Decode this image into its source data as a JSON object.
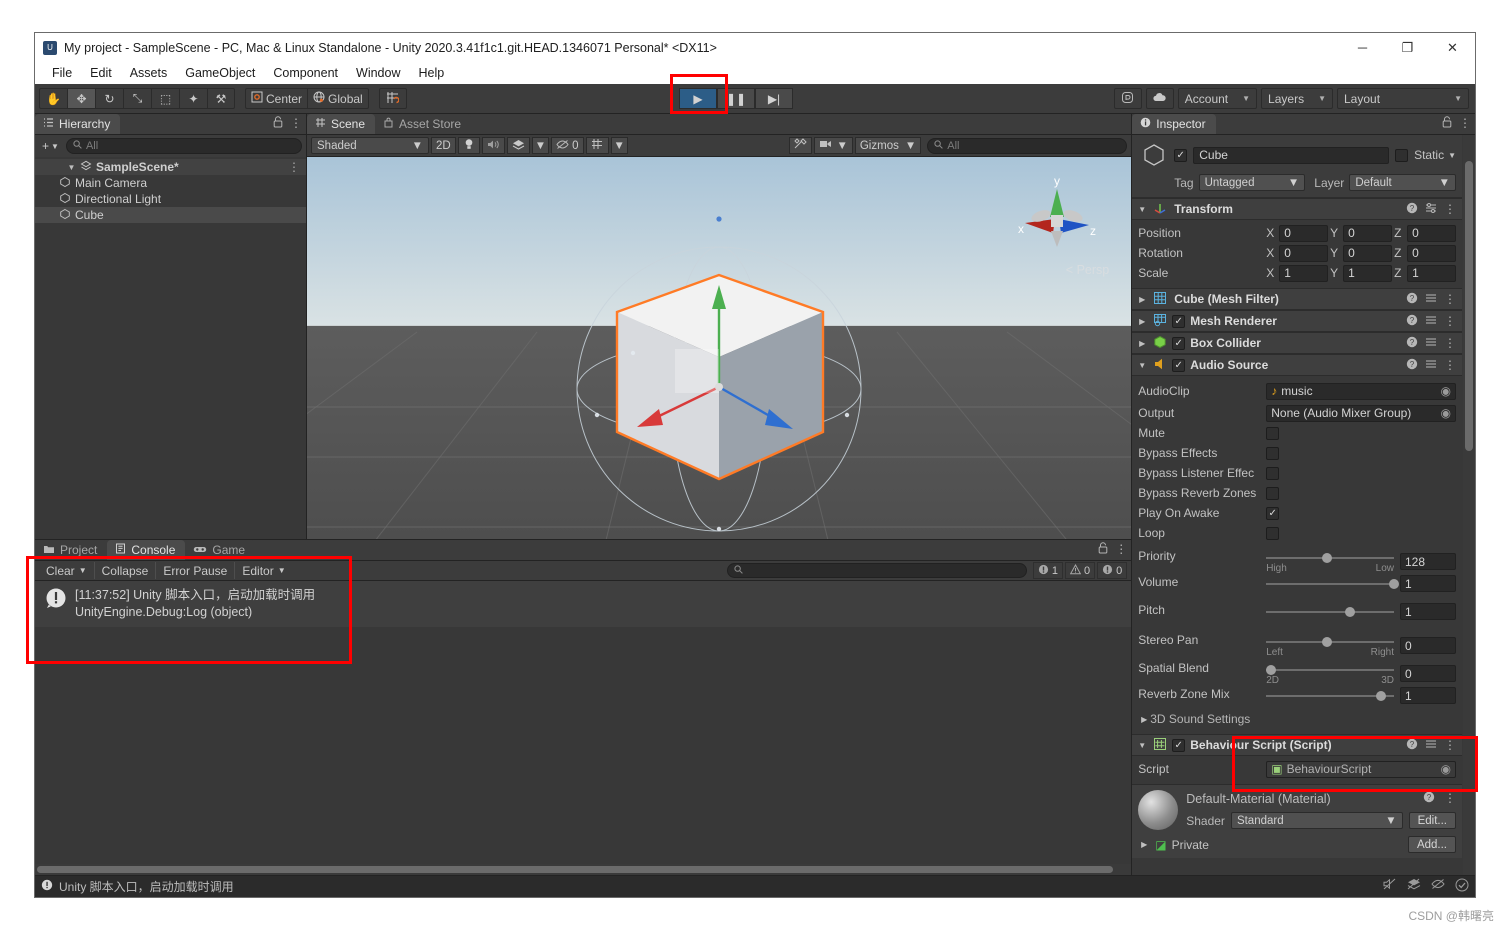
{
  "window": {
    "title": "My project - SampleScene - PC, Mac & Linux Standalone - Unity 2020.3.41f1c1.git.HEAD.1346071 Personal* <DX11>",
    "minimize": "─",
    "maximize": "❐",
    "close": "✕"
  },
  "menu": {
    "items": [
      "File",
      "Edit",
      "Assets",
      "GameObject",
      "Component",
      "Window",
      "Help"
    ]
  },
  "toolbar": {
    "tools": [
      {
        "name": "hand-tool",
        "glyph": "✋",
        "active": false
      },
      {
        "name": "move-tool",
        "glyph": "✥",
        "active": true
      },
      {
        "name": "rotate-tool",
        "glyph": "↻",
        "active": false
      },
      {
        "name": "scale-tool",
        "glyph": "⤡",
        "active": false
      },
      {
        "name": "rect-tool",
        "glyph": "⬚",
        "active": false
      },
      {
        "name": "transform-tool",
        "glyph": "✦",
        "active": false
      },
      {
        "name": "custom-tool",
        "glyph": "⚒",
        "active": false
      }
    ],
    "pivot_label": "Center",
    "space_label": "Global",
    "snap_label": "grid-snapping",
    "play_label": "▶",
    "pause_label": "❚❚",
    "step_label": "▶|",
    "collab_label": "collab-icon",
    "cloud_label": "cloud-icon",
    "account_label": "Account",
    "layers_label": "Layers",
    "layout_label": "Layout"
  },
  "hierarchy": {
    "tab_label": "Hierarchy",
    "add_label": "+",
    "search_placeholder": "All",
    "items": [
      {
        "label": "SampleScene*",
        "icon": "scene-icon",
        "depth": 0,
        "selected": false,
        "expanded": true
      },
      {
        "label": "Main Camera",
        "icon": "gameobject-icon",
        "depth": 1,
        "selected": false
      },
      {
        "label": "Directional Light",
        "icon": "gameobject-icon",
        "depth": 1,
        "selected": false
      },
      {
        "label": "Cube",
        "icon": "gameobject-icon",
        "depth": 1,
        "selected": true
      }
    ]
  },
  "scene": {
    "tabs": [
      {
        "label": "Scene",
        "active": true
      },
      {
        "label": "Asset Store",
        "active": false
      }
    ],
    "shading_label": "Shaded",
    "mode_2d_label": "2D",
    "lighting_label": "lighting-icon",
    "audio_label": "audio-icon",
    "fx_label": "fx-icon",
    "hidden_count": "0",
    "grid_label": "grid-icon",
    "gizmos_label": "Gizmos",
    "search_placeholder": "All",
    "persp_label": "< Persp",
    "axis_x": "x",
    "axis_y": "y",
    "axis_z": "z"
  },
  "console": {
    "tabs": [
      {
        "label": "Project",
        "active": false,
        "icon": "folder-icon"
      },
      {
        "label": "Console",
        "active": true,
        "icon": "console-icon"
      },
      {
        "label": "Game",
        "active": false,
        "icon": "game-icon"
      }
    ],
    "clear_label": "Clear",
    "collapse_label": "Collapse",
    "error_pause_label": "Error Pause",
    "editor_label": "Editor",
    "search_placeholder": "",
    "counts": {
      "info": "1",
      "warning": "0",
      "error": "0"
    },
    "log": {
      "line1": "[11:37:52] Unity 脚本入口，启动加载时调用",
      "line2": "UnityEngine.Debug:Log (object)"
    }
  },
  "inspector": {
    "tab_label": "Inspector",
    "object_name": "Cube",
    "object_enabled": true,
    "static_label": "Static",
    "tag_label": "Tag",
    "tag_value": "Untagged",
    "layer_label": "Layer",
    "layer_value": "Default",
    "transform": {
      "title": "Transform",
      "rows": [
        {
          "label": "Position",
          "x": "0",
          "y": "0",
          "z": "0"
        },
        {
          "label": "Rotation",
          "x": "0",
          "y": "0",
          "z": "0"
        },
        {
          "label": "Scale",
          "x": "1",
          "y": "1",
          "z": "1"
        }
      ],
      "axis_x": "X",
      "axis_y": "Y",
      "axis_z": "Z"
    },
    "components": [
      {
        "title": "Cube (Mesh Filter)",
        "icon": "mesh-filter-icon",
        "has_toggle": false,
        "expanded": false
      },
      {
        "title": "Mesh Renderer",
        "icon": "mesh-renderer-icon",
        "has_toggle": true,
        "checked": true,
        "expanded": false
      },
      {
        "title": "Box Collider",
        "icon": "box-collider-icon",
        "has_toggle": true,
        "checked": true,
        "expanded": false
      },
      {
        "title": "Audio Source",
        "icon": "audio-source-icon",
        "has_toggle": true,
        "checked": true,
        "expanded": true
      }
    ],
    "audio_source": {
      "audioclip_label": "AudioClip",
      "audioclip_value": "music",
      "output_label": "Output",
      "output_value": "None (Audio Mixer Group)",
      "mute_label": "Mute",
      "mute_checked": false,
      "bypass_effects_label": "Bypass Effects",
      "bypass_effects_checked": false,
      "bypass_listener_label": "Bypass Listener Effec",
      "bypass_listener_checked": false,
      "bypass_reverb_label": "Bypass Reverb Zones",
      "bypass_reverb_checked": false,
      "play_on_awake_label": "Play On Awake",
      "play_on_awake_checked": true,
      "loop_label": "Loop",
      "loop_checked": false,
      "sliders": [
        {
          "label": "Priority",
          "value": "128",
          "pos": 46,
          "left": "High",
          "right": "Low"
        },
        {
          "label": "Volume",
          "value": "1",
          "pos": 100,
          "left": "",
          "right": ""
        },
        {
          "label": "Pitch",
          "value": "1",
          "pos": 65,
          "left": "",
          "right": ""
        },
        {
          "label": "Stereo Pan",
          "value": "0",
          "pos": 46,
          "left": "Left",
          "right": "Right"
        },
        {
          "label": "Spatial Blend",
          "value": "0",
          "pos": 2,
          "left": "2D",
          "right": "3D"
        },
        {
          "label": "Reverb Zone Mix",
          "value": "1",
          "pos": 88,
          "left": "",
          "right": ""
        }
      ],
      "sound3d_label": "3D Sound Settings"
    },
    "script_component": {
      "title": "Behaviour Script (Script)",
      "checked": true,
      "script_label": "Script",
      "script_value": "BehaviourScript"
    },
    "material": {
      "title": "Default-Material (Material)",
      "shader_label": "Shader",
      "shader_value": "Standard",
      "edit_label": "Edit...",
      "private_label": "Private",
      "add_label": "Add..."
    }
  },
  "status": {
    "message": "Unity 脚本入口，启动加载时调用",
    "icons": [
      "mute-icon",
      "layers-icon",
      "eye-off-icon",
      "check-icon"
    ]
  },
  "watermark": "CSDN @韩曙亮",
  "colors": {
    "accent_blue": "#2c5d87",
    "annotation_red": "#ff0000",
    "selection_orange": "#ff7b26"
  }
}
